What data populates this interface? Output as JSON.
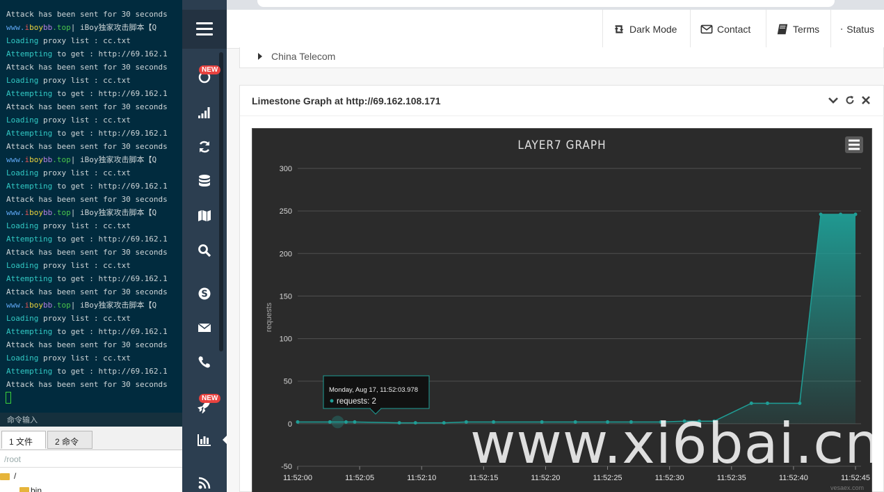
{
  "terminal": {
    "lines": [
      {
        "parts": [
          {
            "t": "Attack has been sent for 30 seconds",
            "c": ""
          }
        ]
      },
      {
        "parts": [
          {
            "t": "www.",
            "c": "s5"
          },
          {
            "t": "i",
            "c": "s1"
          },
          {
            "t": "boy",
            "c": "s2"
          },
          {
            "t": "bb",
            "c": "s4"
          },
          {
            "t": ".top",
            "c": "s3"
          },
          {
            "t": "| iBoy独家攻击脚本【Q",
            "c": ""
          }
        ]
      },
      {
        "parts": [
          {
            "t": "Loading",
            "c": "kw"
          },
          {
            "t": " proxy list : cc.txt",
            "c": ""
          }
        ]
      },
      {
        "parts": [
          {
            "t": "Attempting",
            "c": "kw"
          },
          {
            "t": " to get : http://69.162.1",
            "c": ""
          }
        ]
      },
      {
        "parts": [
          {
            "t": "Attack has been sent for 30 seconds",
            "c": ""
          }
        ]
      },
      {
        "parts": [
          {
            "t": "Loading",
            "c": "kw"
          },
          {
            "t": " proxy list : cc.txt",
            "c": ""
          }
        ]
      },
      {
        "parts": [
          {
            "t": "Attempting",
            "c": "kw"
          },
          {
            "t": " to get : http://69.162.1",
            "c": ""
          }
        ]
      },
      {
        "parts": [
          {
            "t": "Attack has been sent for 30 seconds",
            "c": ""
          }
        ]
      },
      {
        "parts": [
          {
            "t": "Loading",
            "c": "kw"
          },
          {
            "t": " proxy list : cc.txt",
            "c": ""
          }
        ]
      },
      {
        "parts": [
          {
            "t": "Attempting",
            "c": "kw"
          },
          {
            "t": " to get : http://69.162.1",
            "c": ""
          }
        ]
      },
      {
        "parts": [
          {
            "t": "Attack has been sent for 30 seconds",
            "c": ""
          }
        ]
      },
      {
        "parts": [
          {
            "t": "www.",
            "c": "s5"
          },
          {
            "t": "i",
            "c": "s1"
          },
          {
            "t": "boy",
            "c": "s2"
          },
          {
            "t": "bb",
            "c": "s4"
          },
          {
            "t": ".top",
            "c": "s3"
          },
          {
            "t": "| iBoy独家攻击脚本【Q",
            "c": ""
          }
        ]
      },
      {
        "parts": [
          {
            "t": "Loading",
            "c": "kw"
          },
          {
            "t": " proxy list : cc.txt",
            "c": ""
          }
        ]
      },
      {
        "parts": [
          {
            "t": "Attempting",
            "c": "kw"
          },
          {
            "t": " to get : http://69.162.1",
            "c": ""
          }
        ]
      },
      {
        "parts": [
          {
            "t": "Attack has been sent for 30 seconds",
            "c": ""
          }
        ]
      },
      {
        "parts": [
          {
            "t": "www.",
            "c": "s5"
          },
          {
            "t": "i",
            "c": "s1"
          },
          {
            "t": "boy",
            "c": "s2"
          },
          {
            "t": "bb",
            "c": "s4"
          },
          {
            "t": ".top",
            "c": "s3"
          },
          {
            "t": "| iBoy独家攻击脚本【Q",
            "c": ""
          }
        ]
      },
      {
        "parts": [
          {
            "t": "Loading",
            "c": "kw"
          },
          {
            "t": " proxy list : cc.txt",
            "c": ""
          }
        ]
      },
      {
        "parts": [
          {
            "t": "Attempting",
            "c": "kw"
          },
          {
            "t": " to get : http://69.162.1",
            "c": ""
          }
        ]
      },
      {
        "parts": [
          {
            "t": "Attack has been sent for 30 seconds",
            "c": ""
          }
        ]
      },
      {
        "parts": [
          {
            "t": "Loading",
            "c": "kw"
          },
          {
            "t": " proxy list : cc.txt",
            "c": ""
          }
        ]
      },
      {
        "parts": [
          {
            "t": "Attempting",
            "c": "kw"
          },
          {
            "t": " to get : http://69.162.1",
            "c": ""
          }
        ]
      },
      {
        "parts": [
          {
            "t": "Attack has been sent for 30 seconds",
            "c": ""
          }
        ]
      },
      {
        "parts": [
          {
            "t": "www.",
            "c": "s5"
          },
          {
            "t": "i",
            "c": "s1"
          },
          {
            "t": "boy",
            "c": "s2"
          },
          {
            "t": "bb",
            "c": "s4"
          },
          {
            "t": ".top",
            "c": "s3"
          },
          {
            "t": "| iBoy独家攻击脚本【Q",
            "c": ""
          }
        ]
      },
      {
        "parts": [
          {
            "t": "Loading",
            "c": "kw"
          },
          {
            "t": " proxy list : cc.txt",
            "c": ""
          }
        ]
      },
      {
        "parts": [
          {
            "t": "Attempting",
            "c": "kw"
          },
          {
            "t": " to get : http://69.162.1",
            "c": ""
          }
        ]
      },
      {
        "parts": [
          {
            "t": "Attack has been sent for 30 seconds",
            "c": ""
          }
        ]
      },
      {
        "parts": [
          {
            "t": "Loading",
            "c": "kw"
          },
          {
            "t": " proxy list : cc.txt",
            "c": ""
          }
        ]
      },
      {
        "parts": [
          {
            "t": "Attempting",
            "c": "kw"
          },
          {
            "t": " to get : http://69.162.1",
            "c": ""
          }
        ]
      },
      {
        "parts": [
          {
            "t": "Attack has been sent for 30 seconds",
            "c": ""
          }
        ]
      }
    ],
    "command_input_label": "命令输入",
    "tabs": [
      "1 文件",
      "2 命令"
    ],
    "path": "/root",
    "tree": [
      "/",
      "bin"
    ]
  },
  "nav": {
    "badges": [
      "NEW",
      "NEW"
    ],
    "icons": [
      "circle-icon",
      "signal-icon",
      "refresh-icon",
      "database-icon",
      "map-icon",
      "search-icon",
      "skype-icon",
      "envelope-icon",
      "phone-icon",
      "rocket-icon",
      "bar-chart-icon",
      "rss-icon"
    ]
  },
  "topbar": {
    "buttons": [
      {
        "label": "Dark Mode",
        "icon": "retweet-icon"
      },
      {
        "label": "Contact",
        "icon": "envelope-icon"
      },
      {
        "label": "Terms",
        "icon": "book-icon"
      },
      {
        "label": "Status",
        "icon": "gear-icon"
      }
    ]
  },
  "isp": {
    "label": "China Telecom"
  },
  "panel": {
    "title": "Limestone Graph at http://69.162.108.171"
  },
  "tooltip": {
    "date": "Monday, Aug 17, 11:52:03.978",
    "series": "requests",
    "value": "2"
  },
  "credit": "vesaex.com",
  "watermark": "www.xi6bai.cn",
  "colors": {
    "accent": "#1f9e96",
    "chart_bg": "#2b2b2b",
    "nav_bg": "#2c3e50",
    "terminal_bg": "#012b3e",
    "badge": "#e8423f"
  },
  "chart_data": {
    "type": "area",
    "title": "LAYER7 GRAPH",
    "ylabel": "requests",
    "ylim": [
      -50,
      300
    ],
    "yticks": [
      -50,
      0,
      50,
      100,
      150,
      200,
      250,
      300
    ],
    "xticks": [
      "11:52:00",
      "11:52:05",
      "11:52:10",
      "11:52:15",
      "11:52:20",
      "11:52:25",
      "11:52:30",
      "11:52:35",
      "11:52:40",
      "11:52:45"
    ],
    "xlim": [
      0,
      45
    ],
    "series": [
      {
        "name": "requests",
        "x": [
          0,
          2.6,
          3.9,
          4.6,
          8.2,
          9.5,
          11.8,
          13.6,
          15.8,
          19.7,
          22.4,
          25,
          26.9,
          29.3,
          31.2,
          32.4,
          33.6,
          36.6,
          37.9,
          40.5,
          42.2,
          43.8,
          45.3
        ],
        "y": [
          2,
          2,
          2,
          2,
          1,
          1,
          1,
          2,
          2,
          2,
          2,
          2,
          2,
          2,
          3,
          3,
          3,
          24,
          24,
          24,
          246,
          246,
          246
        ]
      }
    ],
    "grid": true
  }
}
